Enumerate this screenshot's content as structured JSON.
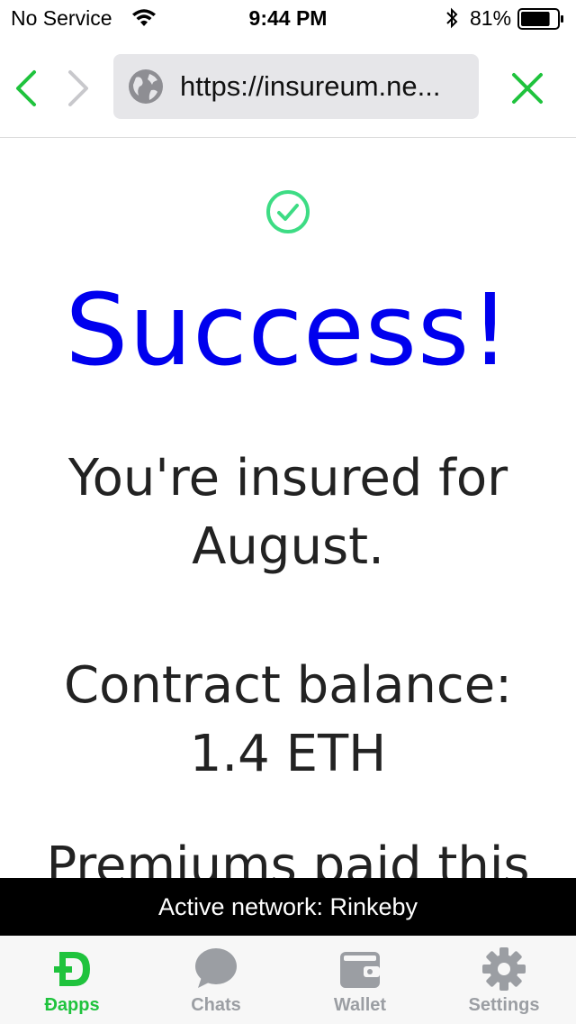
{
  "status_bar": {
    "carrier": "No Service",
    "time": "9:44 PM",
    "battery_percent": "81%",
    "battery_level": 0.81
  },
  "nav": {
    "url": "https://insureum.ne..."
  },
  "content": {
    "headline": "Success!",
    "line1": "You're insured for August.",
    "line2": "Contract balance: 1.4 ETH",
    "line3": "Premiums paid this"
  },
  "banner": {
    "text": "Active network: Rinkeby"
  },
  "tabs": [
    {
      "label": "Ðapps",
      "icon": "dapps-icon",
      "active": true
    },
    {
      "label": "Chats",
      "icon": "chat-bubble-icon",
      "active": false
    },
    {
      "label": "Wallet",
      "icon": "wallet-icon",
      "active": false
    },
    {
      "label": "Settings",
      "icon": "gear-icon",
      "active": false
    }
  ],
  "colors": {
    "accent_green": "#1fc33d",
    "link_blue": "#0000ee",
    "tab_inactive": "#9b9ea3"
  }
}
